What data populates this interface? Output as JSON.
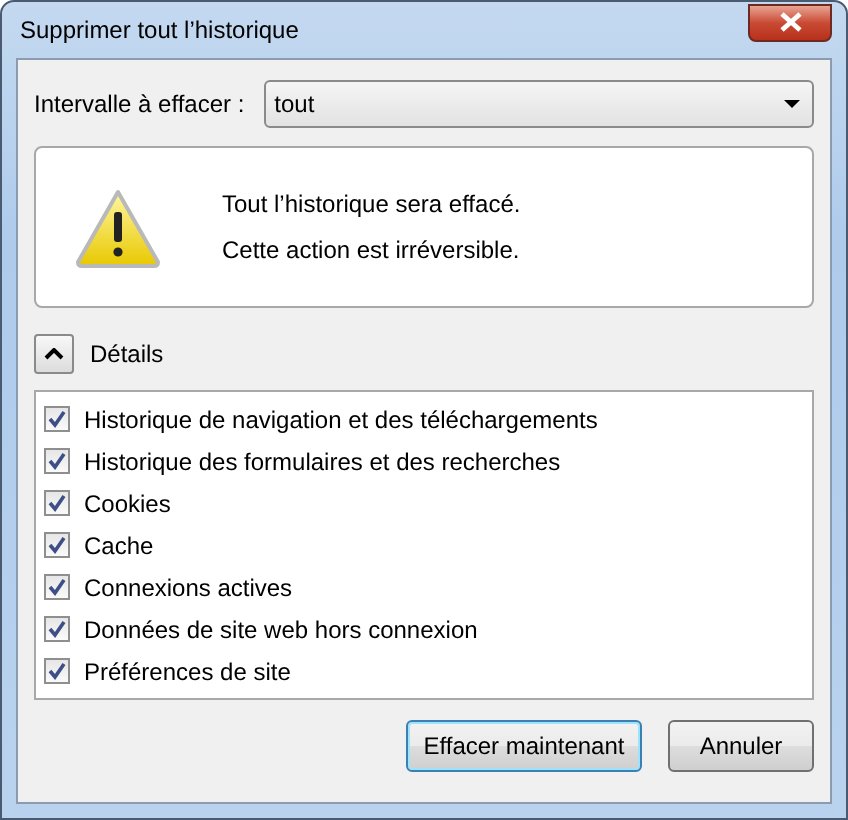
{
  "window": {
    "title": "Supprimer tout l’historique"
  },
  "range": {
    "label": "Intervalle à effacer :",
    "value": "tout"
  },
  "warning": {
    "lines": [
      "Tout l’historique sera effacé.",
      "Cette action est irréversible."
    ]
  },
  "details": {
    "label": "Détails",
    "expanded": true
  },
  "items": [
    {
      "label": "Historique de navigation et des téléchargements",
      "checked": true
    },
    {
      "label": "Historique des formulaires et des recherches",
      "checked": true
    },
    {
      "label": "Cookies",
      "checked": true
    },
    {
      "label": "Cache",
      "checked": true
    },
    {
      "label": "Connexions actives",
      "checked": true
    },
    {
      "label": "Données de site web hors connexion",
      "checked": true
    },
    {
      "label": "Préférences de site",
      "checked": true
    }
  ],
  "buttons": [
    {
      "label": "Effacer maintenant",
      "default": true
    },
    {
      "label": "Annuler",
      "default": false
    }
  ]
}
